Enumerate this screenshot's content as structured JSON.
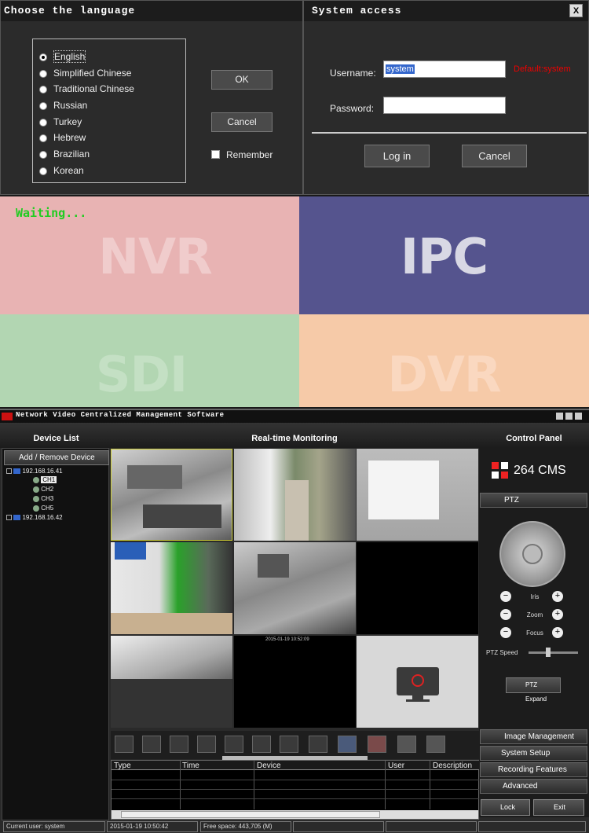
{
  "lang_dialog": {
    "title": "Choose the language",
    "languages": [
      "English",
      "Simplified Chinese",
      "Traditional Chinese",
      "Russian",
      "Turkey",
      "Hebrew",
      "Brazilian",
      "Korean"
    ],
    "selected": 0,
    "ok": "OK",
    "cancel": "Cancel",
    "remember": "Remember"
  },
  "login_dialog": {
    "title": "System access",
    "close": "X",
    "username_label": "Username:",
    "username_value": "system",
    "default_hint": "Default:system",
    "password_label": "Password:",
    "login": "Log in",
    "cancel": "Cancel"
  },
  "splash": {
    "waiting": "Waiting...",
    "nvr": "NVR",
    "ipc": "IPC",
    "sdi": "SDI",
    "dvr": "DVR",
    "colors": {
      "nvr": "#e8b3b3",
      "ipc": "#55548e",
      "sdi": "#b2d6b2",
      "dvr": "#f6caa8",
      "waiting": "#22cc22"
    }
  },
  "app": {
    "title": "Network Video Centralized Management Software",
    "device_list": {
      "header": "Device List",
      "add_remove": "Add / Remove Device",
      "devices": [
        {
          "ip": "192.168.16.41",
          "channels": [
            "CH1",
            "CH2",
            "CH3",
            "CH5"
          ]
        },
        {
          "ip": "192.168.16.42",
          "channels": []
        }
      ]
    },
    "monitor": {
      "header": "Real-time Monitoring",
      "time_stamp": "2015-01-19 10:52:09"
    },
    "log_table": {
      "columns": [
        "Type",
        "Time",
        "Device",
        "User",
        "Description"
      ]
    },
    "control": {
      "header": "Control Panel",
      "brand": "264 CMS",
      "ptz": "PTZ",
      "iris": "Iris",
      "zoom": "Zoom",
      "focus": "Focus",
      "minus": "−",
      "plus": "+",
      "ptz_speed": "PTZ Speed",
      "ptz_expand": "PTZ Expand",
      "menu": [
        "Image Management",
        "System Setup",
        "Recording Features",
        "Advanced"
      ],
      "lock": "Lock",
      "exit": "Exit"
    },
    "status": {
      "user": "Current user: system",
      "time": "2015-01-19 10:50:42",
      "free_space": "Free space: 443,705 (M)"
    }
  }
}
